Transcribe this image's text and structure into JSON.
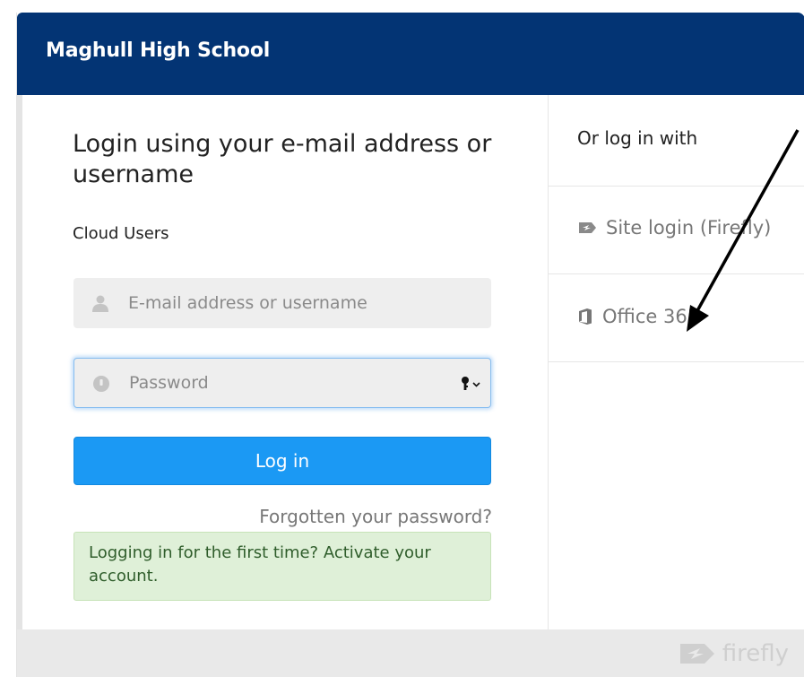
{
  "header": {
    "school_name": "Maghull High School"
  },
  "login_form": {
    "heading": "Login using your e-mail address or username",
    "subheading": "Cloud Users",
    "email_placeholder": "E-mail address or username",
    "password_placeholder": "Password",
    "login_label": "Log in",
    "forgot_label": "Forgotten your password?",
    "first_time_label": "Logging in for the first time? Activate your account."
  },
  "alt_login": {
    "title": "Or log in with",
    "options": [
      {
        "label": "Site login (Firefly)",
        "icon": "firefly-icon"
      },
      {
        "label": "Office 365",
        "icon": "office-icon"
      }
    ]
  },
  "footer": {
    "brand": "firefly"
  },
  "colors": {
    "header_bg": "#033474",
    "button_bg": "#1b99f4",
    "notice_bg": "#dff0d8",
    "notice_text": "#2f5d2b"
  }
}
